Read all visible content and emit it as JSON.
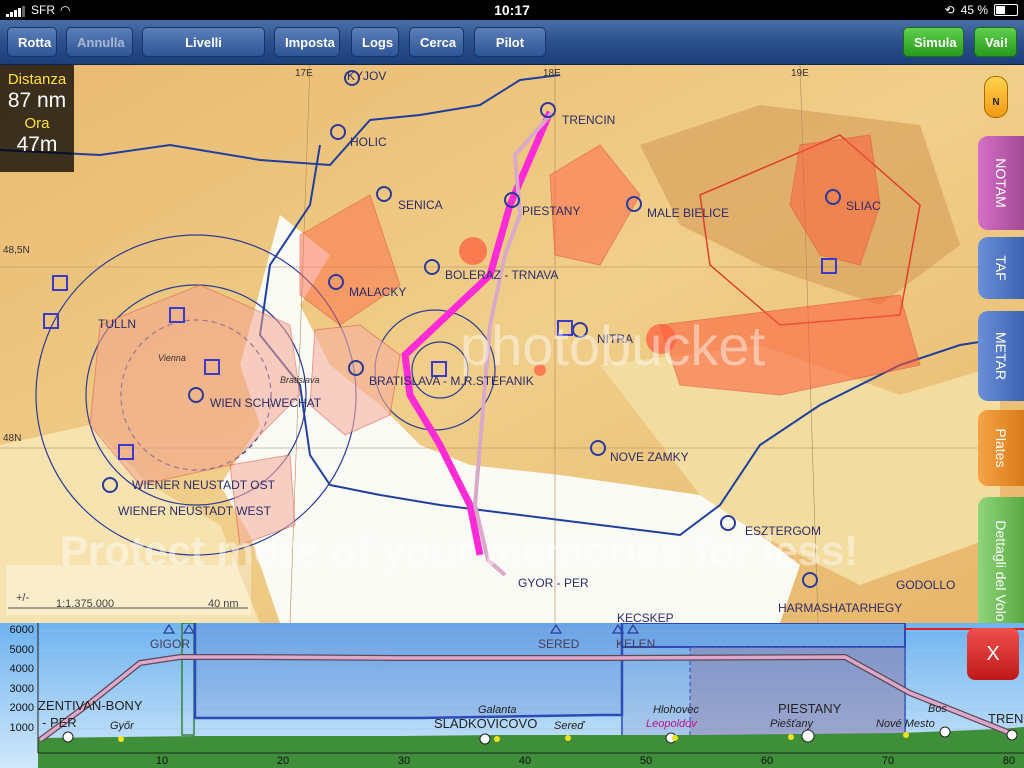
{
  "status": {
    "carrier": "SFR",
    "time": "10:17",
    "battery": "45 %"
  },
  "toolbar": {
    "rotta": "Rotta",
    "annulla": "Annulla",
    "livelli": "Livelli Cartografia",
    "imposta": "Imposta",
    "logs": "Logs",
    "cerca": "Cerca",
    "pilotlog": "Pilot Log",
    "simula": "Simula",
    "vai": "Vai!"
  },
  "info": {
    "distance_label": "Distanza",
    "distance_value": "87 nm",
    "time_label": "Ora",
    "time_value": "47m"
  },
  "compass": "N",
  "side_tabs": [
    "NOTAM",
    "TAF",
    "METAR",
    "Plates",
    "Dettagli del Volo"
  ],
  "close": "X",
  "map": {
    "places": [
      {
        "name": "KYJOV"
      },
      {
        "name": "TRENCIN"
      },
      {
        "name": "HOLIC"
      },
      {
        "name": "SENICA"
      },
      {
        "name": "PIESTANY"
      },
      {
        "name": "MALE BIELICE"
      },
      {
        "name": "SLIAC"
      },
      {
        "name": "BOLERAZ - TRNAVA"
      },
      {
        "name": "MALACKY"
      },
      {
        "name": "TULLN"
      },
      {
        "name": "NITRA"
      },
      {
        "name": "Vienna"
      },
      {
        "name": "BRATISLAVA - M.R.STEFANIK"
      },
      {
        "name": "Bratislava"
      },
      {
        "name": "WIEN SCHWECHAT"
      },
      {
        "name": "NOVE ZAMKY"
      },
      {
        "name": "WIENER NEUSTADT OST"
      },
      {
        "name": "WIENER NEUSTADT WEST"
      },
      {
        "name": "ESZTERGOM"
      },
      {
        "name": "GYOR - PER"
      },
      {
        "name": "GODOLLO"
      },
      {
        "name": "HARMASHATARHEGY"
      },
      {
        "name": "KECSKEP"
      }
    ],
    "grid_labels": {
      "lon17": "17E",
      "lon18": "18E",
      "lon19": "19E",
      "lat485": "48,5N",
      "lat48": "48N"
    },
    "zoom_control": "+/-",
    "scale": "1:1.375.000",
    "scale_bar": "40 nm",
    "watermark": "Protect more of your memories for less!",
    "watermark_brand": "photobucket"
  },
  "profile": {
    "y_ticks": [
      "6000",
      "5000",
      "4000",
      "3000",
      "2000",
      "1000"
    ],
    "x_ticks": [
      "10",
      "20",
      "30",
      "40",
      "50",
      "60",
      "70",
      "80"
    ],
    "waypoints": [
      "GIGOR",
      "SERED",
      "KELEN"
    ],
    "labels": {
      "zentivan": "ZENTIVAN-BONY",
      "per": "- PER",
      "gyor": "Győr",
      "galanta": "Galanta",
      "sladkovicovo": "SLADKOVICOVO",
      "sered": "Sereď",
      "hlohovec": "Hlohovec",
      "leopoldov": "Leopoldov",
      "piestany_big": "PIESTANY",
      "piestany_small": "Piešťany",
      "nove_mesto": "Nové Mesto",
      "bosaca": "Bos",
      "trencin": "TRENC"
    }
  },
  "colors": {
    "toolbar": "#2a4f8c",
    "route": "#ff2bd6",
    "track": "#d9a9c9",
    "airspace_red": "#ff3b2f",
    "airspace_blue": "#2a3a9a"
  }
}
